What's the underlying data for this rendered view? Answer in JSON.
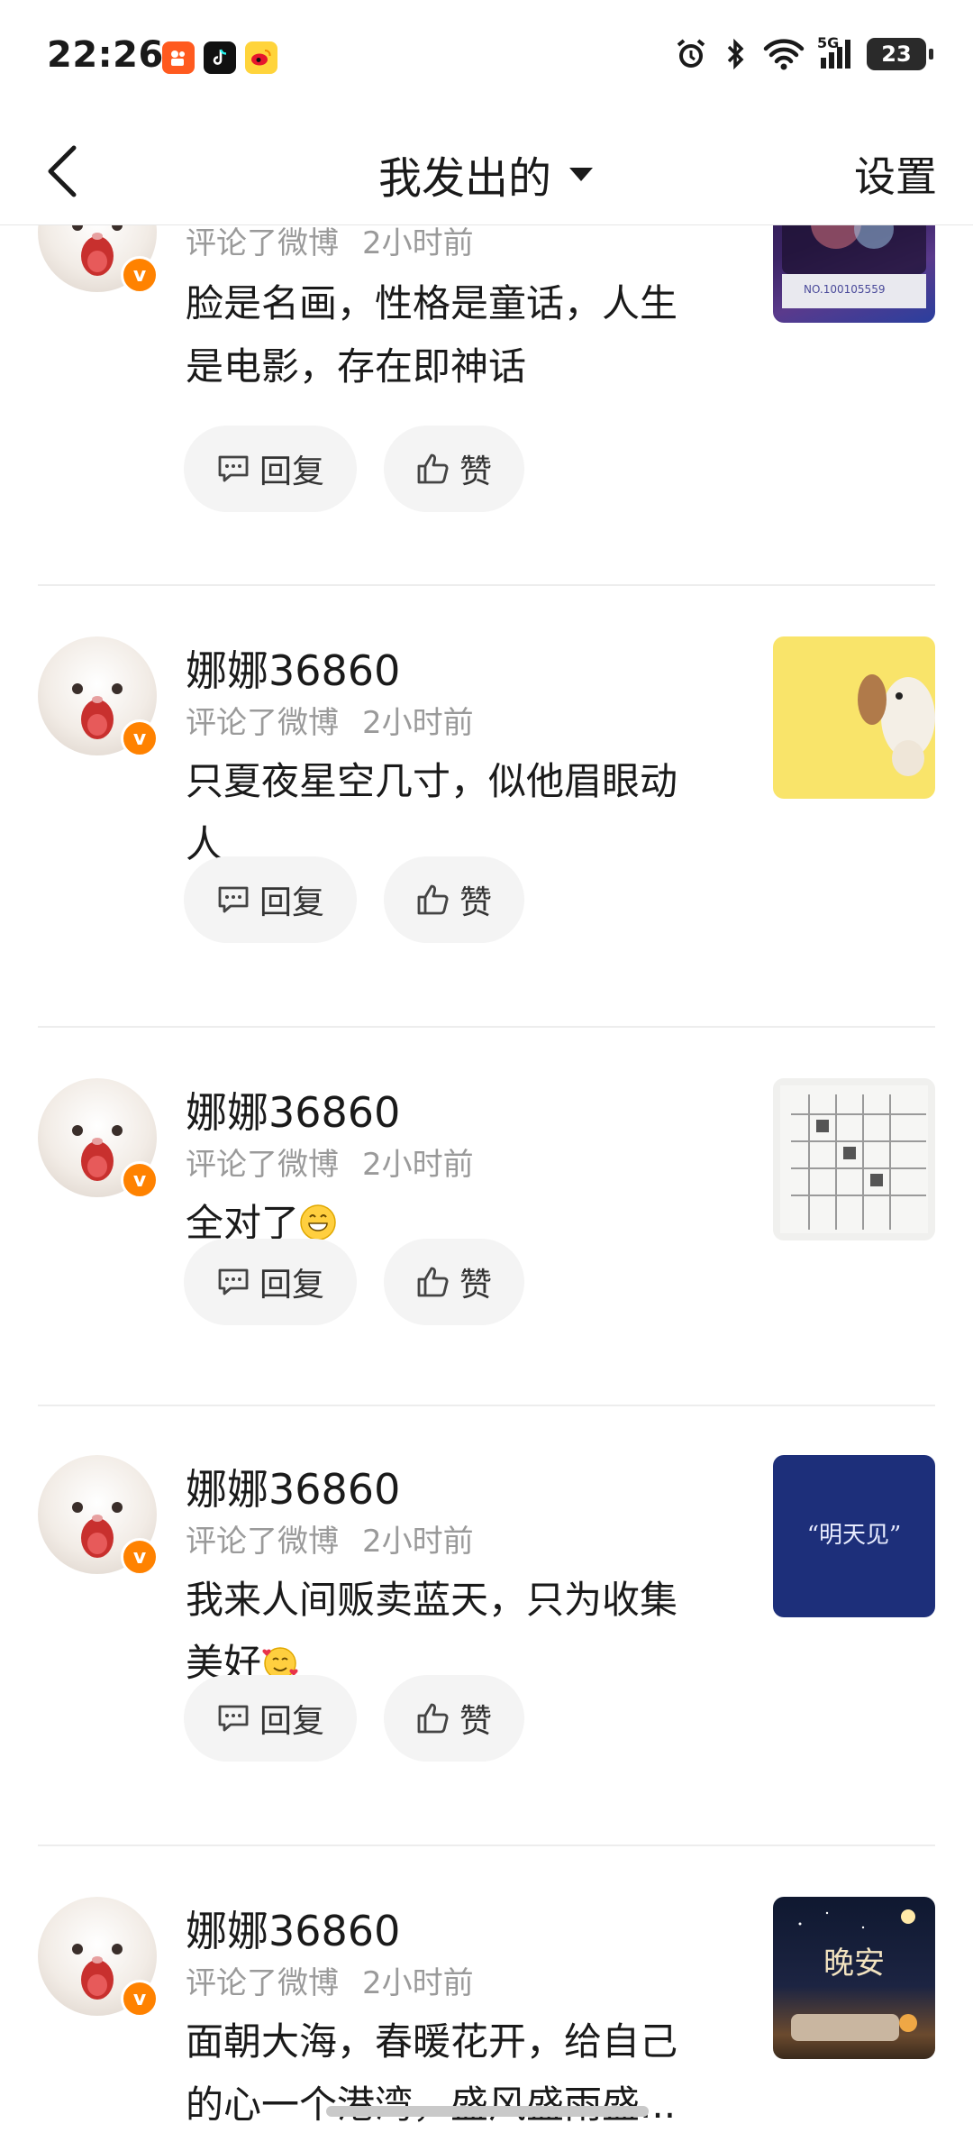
{
  "status_bar": {
    "time": "22:26",
    "apps": [
      {
        "icon": "kuaishou-icon",
        "color": "#ff5a1f"
      },
      {
        "icon": "douyin-icon",
        "color": "#111111"
      },
      {
        "icon": "weibo-icon",
        "color": "#ffd43b"
      }
    ],
    "network": "5G",
    "battery": "23"
  },
  "header": {
    "title": "我发出的",
    "settings_label": "设置"
  },
  "actions": {
    "reply_label": "回复",
    "like_label": "赞"
  },
  "feed": [
    {
      "username": "",
      "action": "评论了微博",
      "time": "2小时前",
      "text_line1": "脸是名画，性格是童话，人生",
      "text_line2": "是电影，存在即神话",
      "thumb": "concert-photo",
      "thumb_caption": "NO.100105559"
    },
    {
      "username": "娜娜36860",
      "action": "评论了微博",
      "time": "2小时前",
      "text_line1": "只夏夜星空几寸，似他眉眼动",
      "text_line2": "人",
      "thumb": "yellow-puppy"
    },
    {
      "username": "娜娜36860",
      "action": "评论了微博",
      "time": "2小时前",
      "text_line1": "全对了",
      "emoji": "grinning-emoji",
      "thumb": "exam-paper"
    },
    {
      "username": "娜娜36860",
      "action": "评论了微博",
      "time": "2小时前",
      "text_line1": "我来人间贩卖蓝天，只为收集",
      "text_line2": "美好",
      "emoji": "smiling-hearts-emoji",
      "thumb": "blue-card",
      "thumb_caption": "“明天见”"
    },
    {
      "username": "娜娜36860",
      "action": "评论了微博",
      "time": "2小时前",
      "text_line1": "面朝大海，春暖花开，给自己",
      "text_line2": "的心一个港湾，盛风盛雨盛...",
      "thumb": "good-night-card",
      "thumb_caption": "晚安"
    }
  ]
}
